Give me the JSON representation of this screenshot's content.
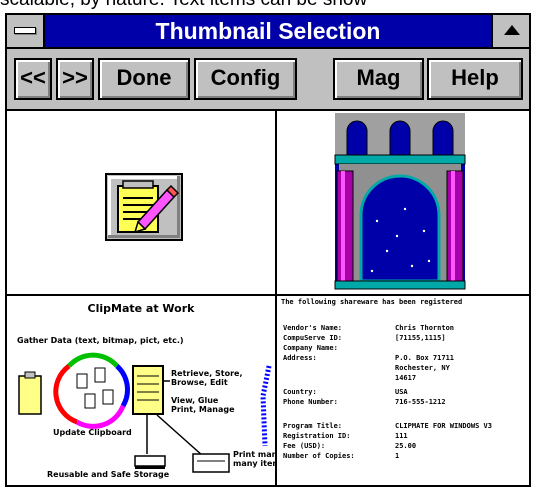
{
  "background_text": "scalable, by nature. Text items can be show",
  "window": {
    "title": "Thumbnail Selection",
    "colors": {
      "titlebar": "#0000a8",
      "face": "#c0c0c0",
      "arch_blue": "#0000a8",
      "arch_teal": "#00a8a8",
      "arch_pink": "#a800a8"
    }
  },
  "toolbar": {
    "buttons": [
      "<<",
      ">>",
      "Done",
      "Config",
      "Mag",
      "Help"
    ]
  },
  "thumbnails": {
    "clipmate_title": "ClipMate at Work",
    "clipmate_labels": {
      "gather": "Gather Data (text, bitmap, pict, etc.)",
      "retrieve": "Retrieve, Store,",
      "browse": "Browse, Edit",
      "view": "View, Glue",
      "print_manage": "Print, Manage",
      "update": "Update Clipboard",
      "print_many": "Print many",
      "many_items": "many items",
      "reusable": "Reusable and Safe Storage"
    },
    "form": {
      "header": "The following shareware has been registered",
      "rows": [
        {
          "label": "Vendor's Name:",
          "value": "Chris Thornton"
        },
        {
          "label": "CompuServe ID:",
          "value": "[71155,1115]"
        },
        {
          "label": "Company Name:",
          "value": ""
        },
        {
          "label": "Address:",
          "value": "P.O. Box 71711"
        },
        {
          "label": "",
          "value": "Rochester, NY"
        },
        {
          "label": "",
          "value": "14617"
        },
        {
          "label": "Country:",
          "value": "USA"
        },
        {
          "label": "Phone Number:",
          "value": "716-555-1212"
        },
        {
          "label": "Program Title:",
          "value": "CLIPMATE FOR WINDOWS V3"
        },
        {
          "label": "Registration ID:",
          "value": "111"
        },
        {
          "label": "Fee (USD):",
          "value": "25.00"
        },
        {
          "label": "Number of Copies:",
          "value": "1"
        }
      ]
    }
  }
}
